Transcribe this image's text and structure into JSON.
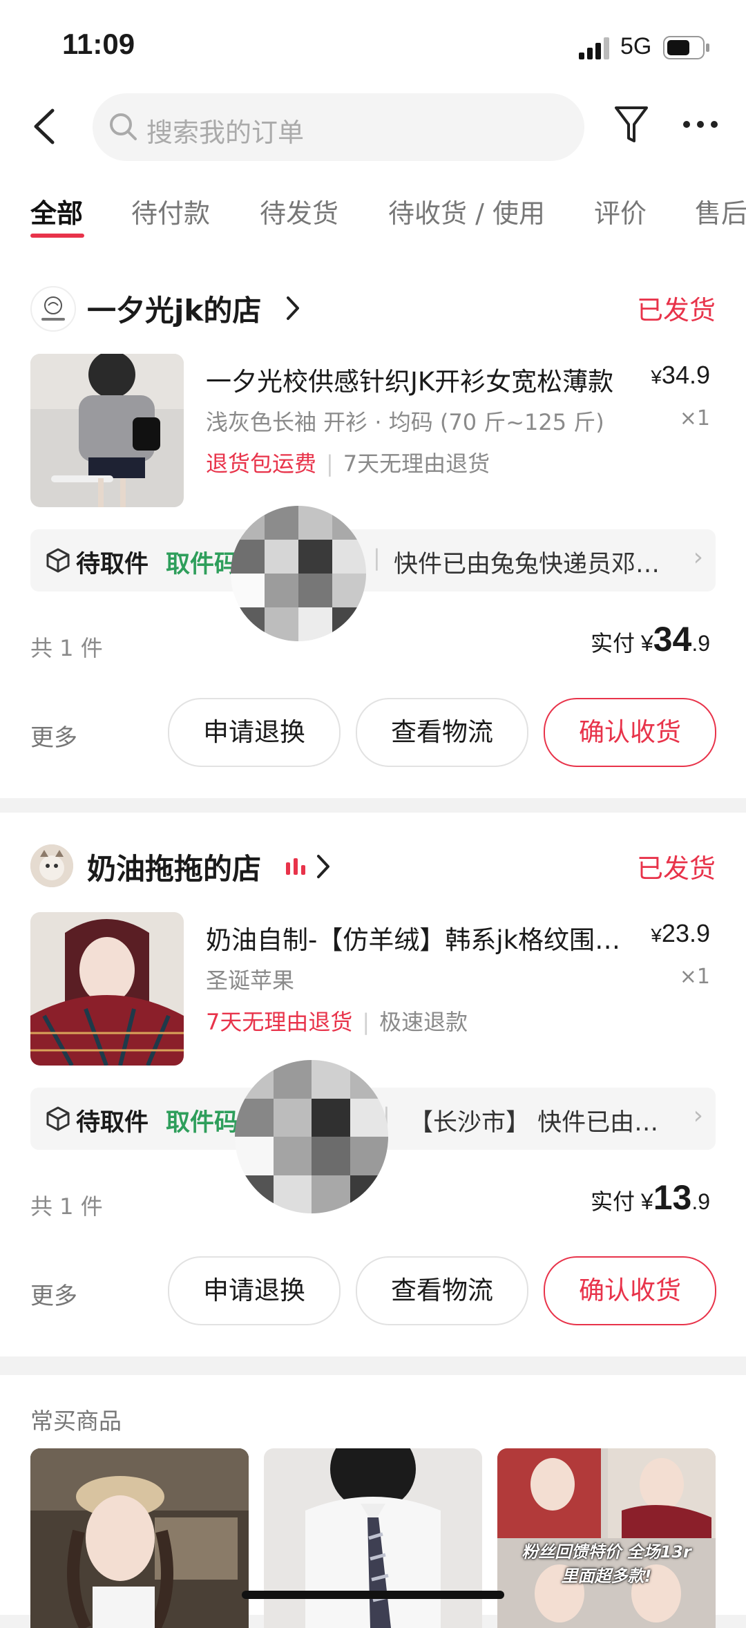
{
  "status_bar": {
    "time": "11:09",
    "network": "5G"
  },
  "search": {
    "placeholder": "搜索我的订单"
  },
  "tabs": [
    {
      "label": "全部",
      "active": true
    },
    {
      "label": "待付款"
    },
    {
      "label": "待发货"
    },
    {
      "label": "待收货 / 使用"
    },
    {
      "label": "评价"
    },
    {
      "label": "售后"
    }
  ],
  "orders": [
    {
      "shop_name": "一夕光jk的店",
      "status": "已发货",
      "product_title": "一夕光校供感针织JK开衫女宽松薄款",
      "price_symbol": "¥",
      "price": "34.9",
      "spec": "浅灰色长袖 开衫 · 均码 (70 斤~125 斤)",
      "qty": "×1",
      "tag1": "退货包运费",
      "tag2": "7天无理由退货",
      "pickup_label": "待取件",
      "pickup_code_label": "取件码",
      "pickup_info": "快件已由兔兔快递员邓师傅揽收",
      "count": "共 1 件",
      "paid_label": "实付",
      "paid_symbol": "¥",
      "paid_int": "34",
      "paid_dec": ".9",
      "more": "更多",
      "btn_return": "申请退换",
      "btn_logistics": "查看物流",
      "btn_confirm": "确认收货"
    },
    {
      "shop_name": "奶油拖拖的店",
      "status": "已发货",
      "product_title": "奶油自制-【仿羊绒】韩系jk格纹围巾女",
      "price_symbol": "¥",
      "price": "23.9",
      "spec": "圣诞苹果",
      "qty": "×1",
      "tag1": "7天无理由退货",
      "tag2": "极速退款",
      "pickup_label": "待取件",
      "pickup_code_label": "取件码",
      "pickup_info": "【长沙市】 快件已由驿站代收",
      "count": "共 1 件",
      "paid_label": "实付",
      "paid_symbol": "¥",
      "paid_int": "13",
      "paid_dec": ".9",
      "more": "更多",
      "btn_return": "申请退换",
      "btn_logistics": "查看物流",
      "btn_confirm": "确认收货"
    }
  ],
  "frequently_bought": {
    "title": "常买商品",
    "banner_text_1": "粉丝回馈特价 全场13r",
    "banner_text_2": "里面超多款!"
  },
  "colors": {
    "accent": "#e8334a",
    "pickup_green": "#2e9e5b",
    "background": "#f2f2f2"
  }
}
